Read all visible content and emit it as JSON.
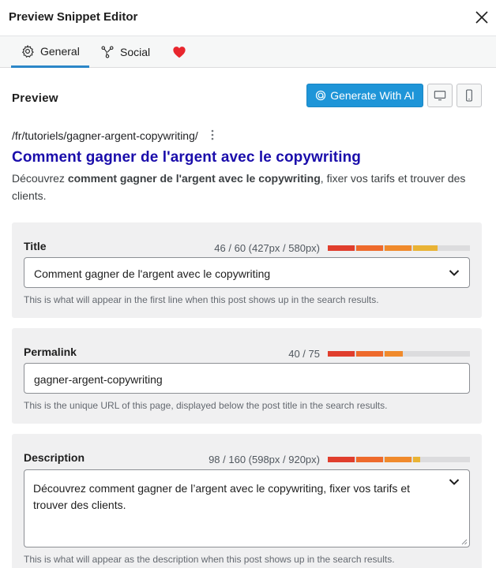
{
  "header": {
    "title": "Preview Snippet Editor"
  },
  "tabs": [
    {
      "label": "General",
      "icon": "gear-icon",
      "active": true
    },
    {
      "label": "Social",
      "icon": "share-icon",
      "active": false
    },
    {
      "label": "",
      "icon": "heart-icon",
      "active": false
    }
  ],
  "preview": {
    "heading": "Preview",
    "ai_button_label": "Generate With AI",
    "devices": [
      "desktop-icon",
      "mobile-icon"
    ]
  },
  "snippet": {
    "url": "/fr/tutoriels/gagner-argent-copywriting/",
    "title": "Comment gagner de l'argent avec le copywriting",
    "desc_prefix": "Découvrez ",
    "desc_bold": "comment gagner de l'argent avec le copywriting",
    "desc_suffix": ", fixer vos tarifs et trouver des clients."
  },
  "fields": {
    "title": {
      "label": "Title",
      "count": "46 / 60 (427px / 580px)",
      "value": "Comment gagner de l'argent avec le copywriting",
      "help": "This is what will appear in the first line when this post shows up in the search results.",
      "fill": 0.77
    },
    "permalink": {
      "label": "Permalink",
      "count": "40 / 75",
      "value": "gagner-argent-copywriting",
      "help": "This is the unique URL of this page, displayed below the post title in the search results.",
      "fill": 0.53
    },
    "description": {
      "label": "Description",
      "count": "98 / 160 (598px / 920px)",
      "value": "Découvrez comment gagner de l’argent avec le copywriting, fixer vos tarifs et trouver des clients.",
      "help": "This is what will appear as the description when this post shows up in the search results.",
      "fill": 0.65
    }
  },
  "colors": {
    "accent": "#2c87c8",
    "ai_button": "#1e95d8",
    "snippet_title": "#1a0dab",
    "heart": "#e8262d",
    "meter": [
      "#e03e2d",
      "#ee6a2c",
      "#f08a2c",
      "#e9b335",
      "#a4c03b"
    ]
  }
}
